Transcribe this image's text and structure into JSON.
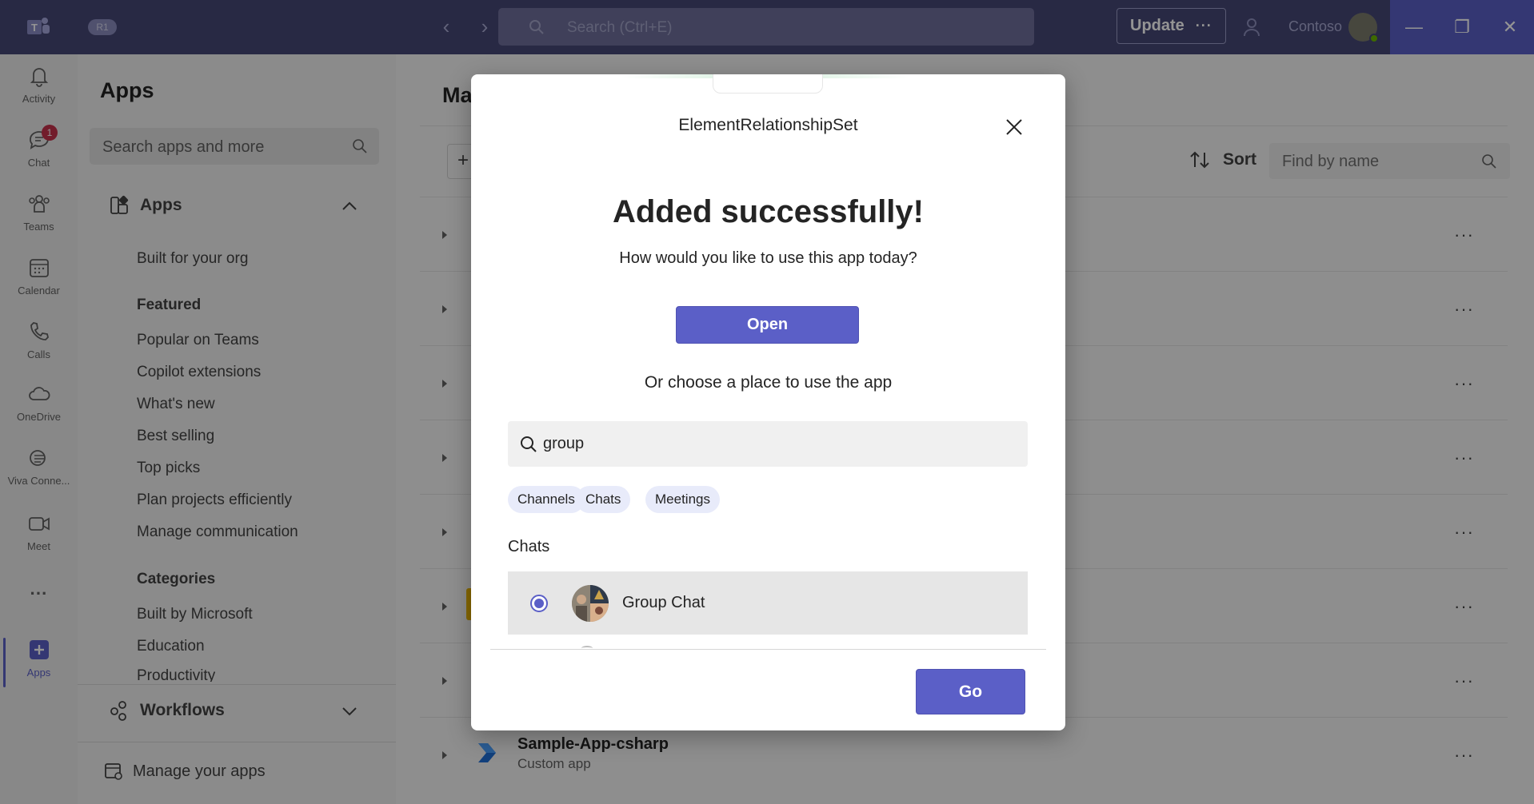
{
  "titlebar": {
    "badge": "R1",
    "search_placeholder": "Search (Ctrl+E)",
    "update_label": "Update",
    "update_more": "···",
    "org_name": "Contoso"
  },
  "rail": {
    "items": [
      {
        "label": "Activity"
      },
      {
        "label": "Chat",
        "badge": "1"
      },
      {
        "label": "Teams"
      },
      {
        "label": "Calendar"
      },
      {
        "label": "Calls"
      },
      {
        "label": "OneDrive"
      },
      {
        "label": "Viva Conne..."
      },
      {
        "label": "Meet"
      },
      {
        "label": "···"
      },
      {
        "label": "Apps"
      }
    ]
  },
  "apps_panel": {
    "title": "Apps",
    "search_placeholder": "Search apps and more",
    "apps_section": "Apps",
    "built_for_org": "Built for your org",
    "featured_heading": "Featured",
    "featured_items": [
      "Popular on Teams",
      "Copilot extensions",
      "What's new",
      "Best selling",
      "Top picks",
      "Plan projects efficiently",
      "Manage communication"
    ],
    "categories_heading": "Categories",
    "category_items": [
      "Built by Microsoft",
      "Education",
      "Productivity"
    ],
    "workflows_section": "Workflows",
    "manage_apps": "Manage your apps"
  },
  "main": {
    "title_fragment": "Ma",
    "add_label": "+",
    "sort_label": "Sort",
    "find_placeholder": "Find by name",
    "row_more": "···",
    "last_row": {
      "name": "Sample-App-csharp",
      "sub": "Custom app"
    }
  },
  "dialog": {
    "title": "ElementRelationshipSet",
    "heading": "Added successfully!",
    "subheading": "How would you like to use this app today?",
    "open_label": "Open",
    "or_label": "Or choose a place to use the app",
    "search_value": "group",
    "pills": [
      "Channels",
      "Chats",
      "Meetings"
    ],
    "section_label": "Chats",
    "selected_item": "Group Chat",
    "go_label": "Go"
  },
  "colors": {
    "titlebar": "#464775",
    "accent": "#5b5fc7",
    "pill_bg": "#e8ebfa",
    "badge": "#c4314b"
  }
}
